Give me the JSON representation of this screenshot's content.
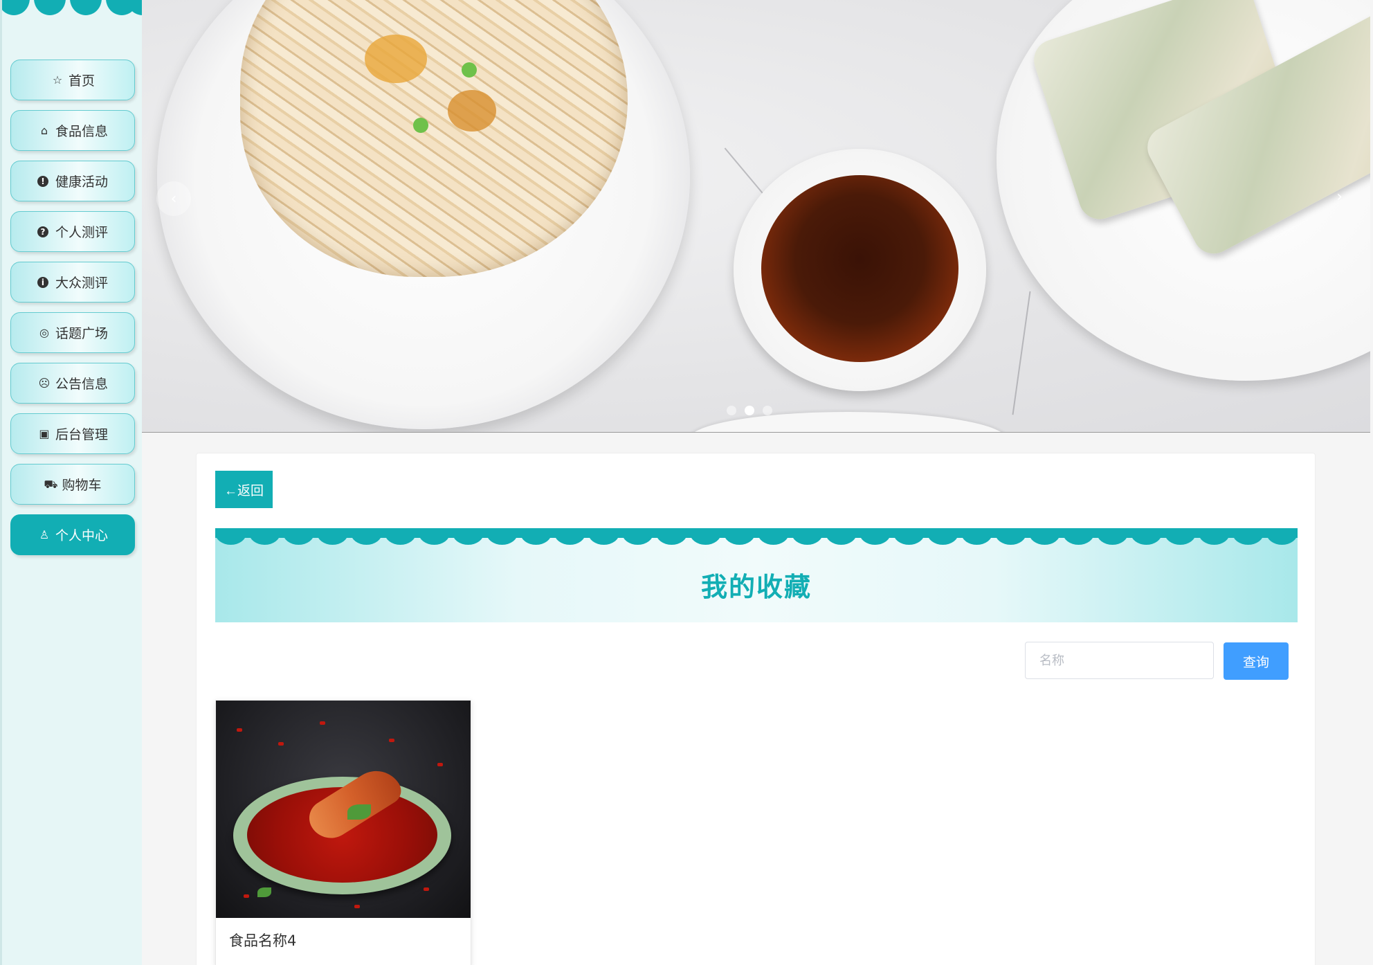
{
  "nav": {
    "items": [
      {
        "label": "首页",
        "icon": "star-icon",
        "glyph": "☆",
        "solid": false,
        "active": false
      },
      {
        "label": "食品信息",
        "icon": "bag-icon",
        "glyph": "⌂",
        "solid": false,
        "active": false
      },
      {
        "label": "健康活动",
        "icon": "exclamation-circle-icon",
        "glyph": "!",
        "solid": true,
        "active": false
      },
      {
        "label": "个人测评",
        "icon": "question-circle-icon",
        "glyph": "?",
        "solid": true,
        "active": false
      },
      {
        "label": "大众测评",
        "icon": "info-circle-icon",
        "glyph": "i",
        "solid": true,
        "active": false
      },
      {
        "label": "话题广场",
        "icon": "smile-icon",
        "glyph": "◎",
        "solid": false,
        "active": false
      },
      {
        "label": "公告信息",
        "icon": "sad-face-icon",
        "glyph": "☹",
        "solid": false,
        "active": false
      },
      {
        "label": "后台管理",
        "icon": "box-icon",
        "glyph": "▣",
        "solid": false,
        "active": false
      },
      {
        "label": "购物车",
        "icon": "cart-icon",
        "glyph": "⛟",
        "solid": false,
        "active": false
      },
      {
        "label": "个人中心",
        "icon": "user-icon",
        "glyph": "♙",
        "solid": false,
        "active": true
      }
    ]
  },
  "carousel": {
    "prev_glyph": "‹",
    "next_glyph": "›",
    "active_dot": 1,
    "dot_count": 3
  },
  "main": {
    "back_label": "←返回",
    "title": "我的收藏",
    "search": {
      "placeholder": "名称",
      "value": "",
      "button_label": "查询"
    },
    "favorites": [
      {
        "name": "食品名称4"
      }
    ]
  },
  "colors": {
    "accent": "#12aeb4",
    "search_button": "#409eff",
    "sidebar_bg": "#e6f6f6"
  }
}
